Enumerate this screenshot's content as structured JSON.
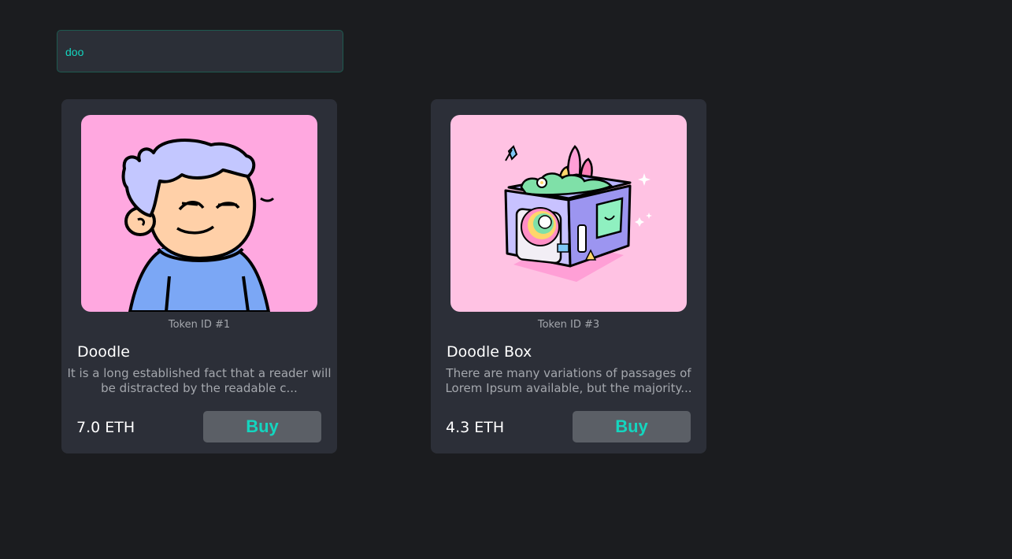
{
  "search": {
    "value": "doo",
    "accent_color": "#14d5bf"
  },
  "cards": [
    {
      "token_id": "Token ID #1",
      "name": "Doodle",
      "description": "It is a long established fact that a reader will be distracted by the readable c...",
      "price": "7.0 ETH",
      "buy_label": "Buy",
      "art": "doodle-character-image"
    },
    {
      "token_id": "Token ID #3",
      "name": "Doodle Box",
      "description": "There are many variations of passages of Lorem Ipsum available, but the majority...",
      "price": "4.3 ETH",
      "buy_label": "Buy",
      "art": "doodle-box-image"
    }
  ],
  "colors": {
    "background": "#1b1c1f",
    "card": "#2c2f38",
    "button": "#5b5f66",
    "accent": "#14d5bf"
  }
}
